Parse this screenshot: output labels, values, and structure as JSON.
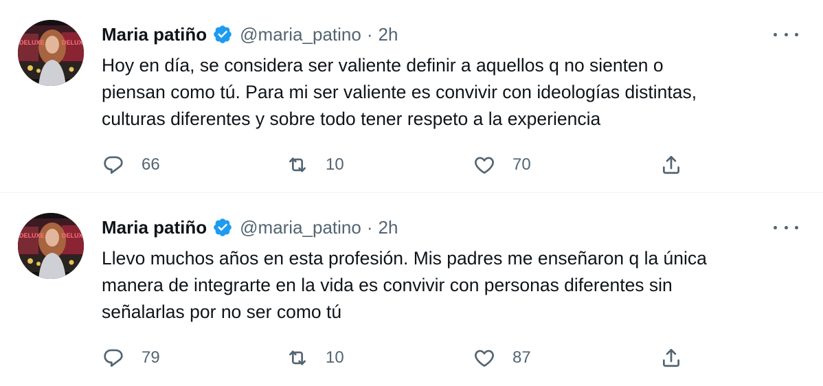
{
  "tweets": [
    {
      "author": {
        "name": "Maria patiño",
        "handle": "@maria_patino",
        "verified": true
      },
      "separator": "·",
      "time": "2h",
      "text": "Hoy en día, se considera ser valiente definir a aquellos q no sienten o\npiensan como tú. Para mi ser valiente es convivir con ideologías distintas,\nculturas diferentes y sobre todo tener respeto a la experiencia",
      "replies": "66",
      "retweets": "10",
      "likes": "70",
      "avatar_text": [
        "DELUXE",
        "DELUXE"
      ]
    },
    {
      "author": {
        "name": "Maria patiño",
        "handle": "@maria_patino",
        "verified": true
      },
      "separator": "·",
      "time": "2h",
      "text": "Llevo muchos años en esta profesión. Mis padres me enseñaron q la única\nmanera de integrarte en la vida es convivir con personas diferentes sin\nseñalarlas por no ser como tú",
      "replies": "79",
      "retweets": "10",
      "likes": "87",
      "avatar_text": [
        "DELUXE",
        "DELUXE"
      ]
    }
  ],
  "colors": {
    "text_primary": "#0f1419",
    "text_secondary": "#536471",
    "verified": "#1d9bf0",
    "divider": "#eff3f4"
  },
  "icons": {
    "reply": "speech-bubble-icon",
    "retweet": "retweet-arrows-icon",
    "like": "heart-icon",
    "share": "share-upload-icon",
    "more": "three-dots-icon",
    "verified": "verified-badge-icon"
  }
}
